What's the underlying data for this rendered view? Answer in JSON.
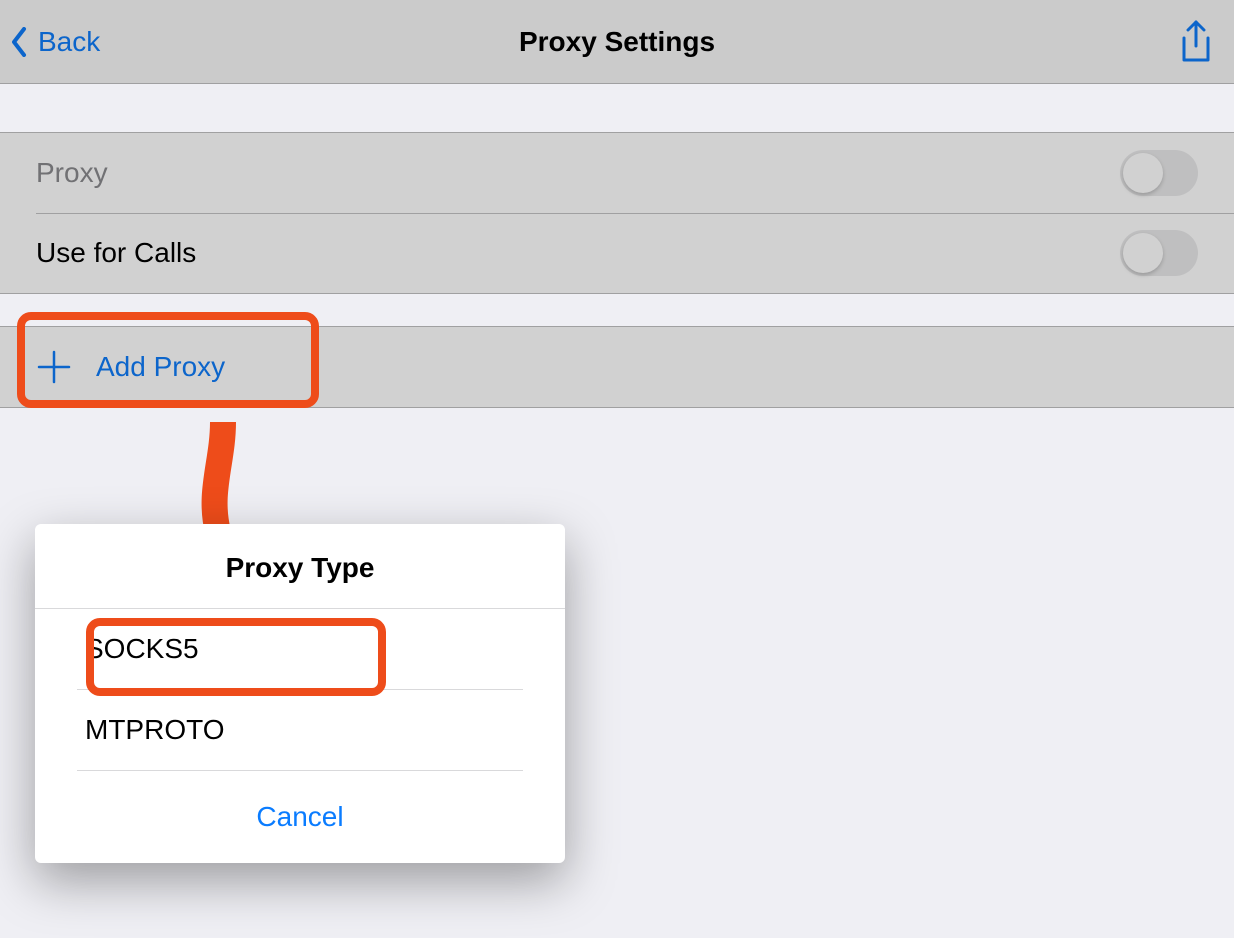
{
  "nav": {
    "back": "Back",
    "title": "Proxy Settings"
  },
  "rows": {
    "proxy": "Proxy",
    "calls": "Use for Calls",
    "add": "Add Proxy"
  },
  "modal": {
    "title": "Proxy Type",
    "options": {
      "socks5": "SOCKS5",
      "mtproto": "MTPROTO"
    },
    "cancel": "Cancel"
  },
  "colors": {
    "accent": "#0a7cff",
    "highlight": "#ee4c1a"
  }
}
